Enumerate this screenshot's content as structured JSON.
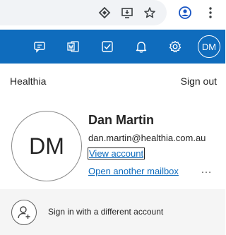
{
  "browser": {
    "icons": [
      "extension-diamond-icon",
      "install-app-icon",
      "bookmark-star-icon",
      "profile-icon",
      "menu-kebab-icon"
    ]
  },
  "app_bar": {
    "icons": [
      "feedback-icon",
      "word-doc-icon",
      "to-do-check-icon",
      "notifications-bell-icon",
      "settings-gear-icon"
    ],
    "avatar_initials": "DM"
  },
  "account": {
    "org_name": "Healthia",
    "sign_out_label": "Sign out",
    "initials": "DM",
    "display_name": "Dan Martin",
    "email": "dan.martin@healthia.com.au",
    "view_account_label": "View account",
    "open_mailbox_label": "Open another mailbox",
    "more_label": "…"
  },
  "other_account": {
    "label": "Sign in with a different account"
  },
  "colors": {
    "brand": "#0f6cbd",
    "text": "#242424"
  }
}
